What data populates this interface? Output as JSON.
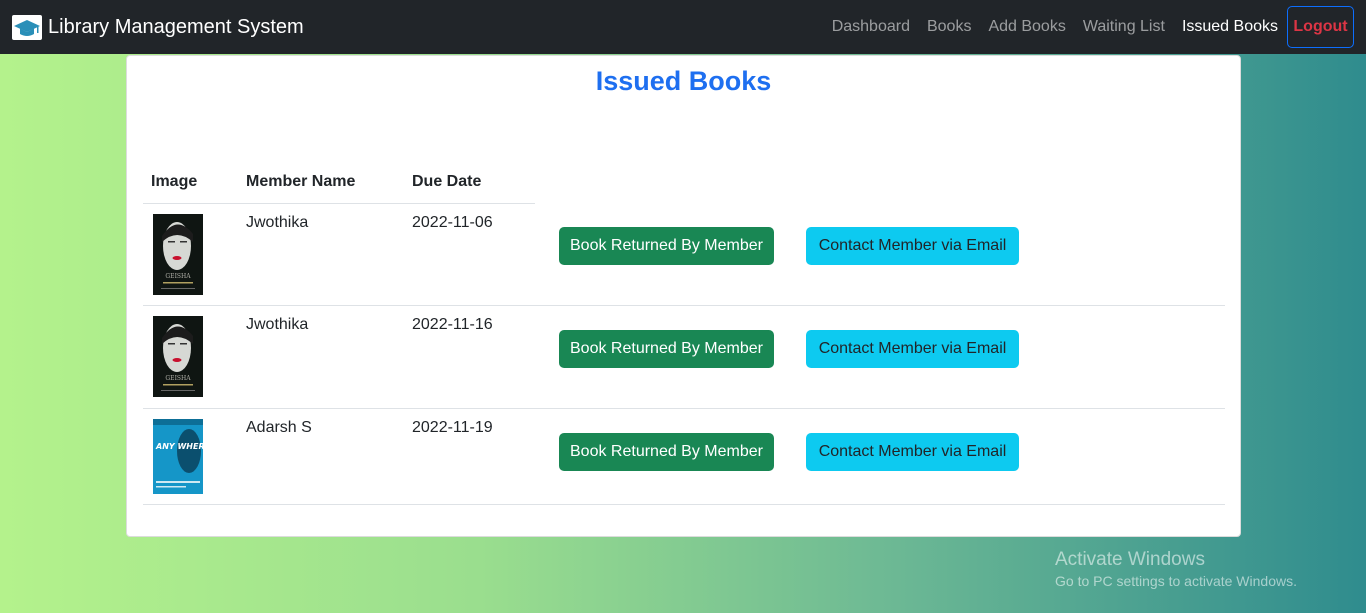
{
  "navbar": {
    "brand_icon": "graduation-cap-icon",
    "brand": "Library Management System",
    "links": [
      "Dashboard",
      "Books",
      "Add Books",
      "Waiting List",
      "Issued Books"
    ],
    "active": "Issued Books",
    "logout": "Logout"
  },
  "page": {
    "title": "Issued Books"
  },
  "table": {
    "headers": [
      "Image",
      "Member Name",
      "Due Date"
    ],
    "rows": [
      {
        "cover": "memoirs-of-a-geisha-cover",
        "cover_text": "GEISHA",
        "member": "Jwothika",
        "due": "2022-11-06",
        "returned_label": "Book Returned By Member",
        "contact_label": "Contact Member via Email"
      },
      {
        "cover": "memoirs-of-a-geisha-cover",
        "cover_text": "GEISHA",
        "member": "Jwothika",
        "due": "2022-11-16",
        "returned_label": "Book Returned By Member",
        "contact_label": "Contact Member via Email"
      },
      {
        "cover": "anywhere-you-run-cover",
        "cover_text": "ANY WHERE YOU RUN",
        "member": "Adarsh S",
        "due": "2022-11-19",
        "returned_label": "Book Returned By Member",
        "contact_label": "Contact Member via Email"
      }
    ]
  },
  "watermark": {
    "title": "Activate Windows",
    "subtitle": "Go to PC settings to activate Windows."
  },
  "colors": {
    "navbar": "#212529",
    "title": "#1e6ff0",
    "success": "#198754",
    "info": "#0dcaf0",
    "logout": "#dc3545",
    "gradient_start": "#b4f28c",
    "gradient_end": "#2f8c8e"
  }
}
